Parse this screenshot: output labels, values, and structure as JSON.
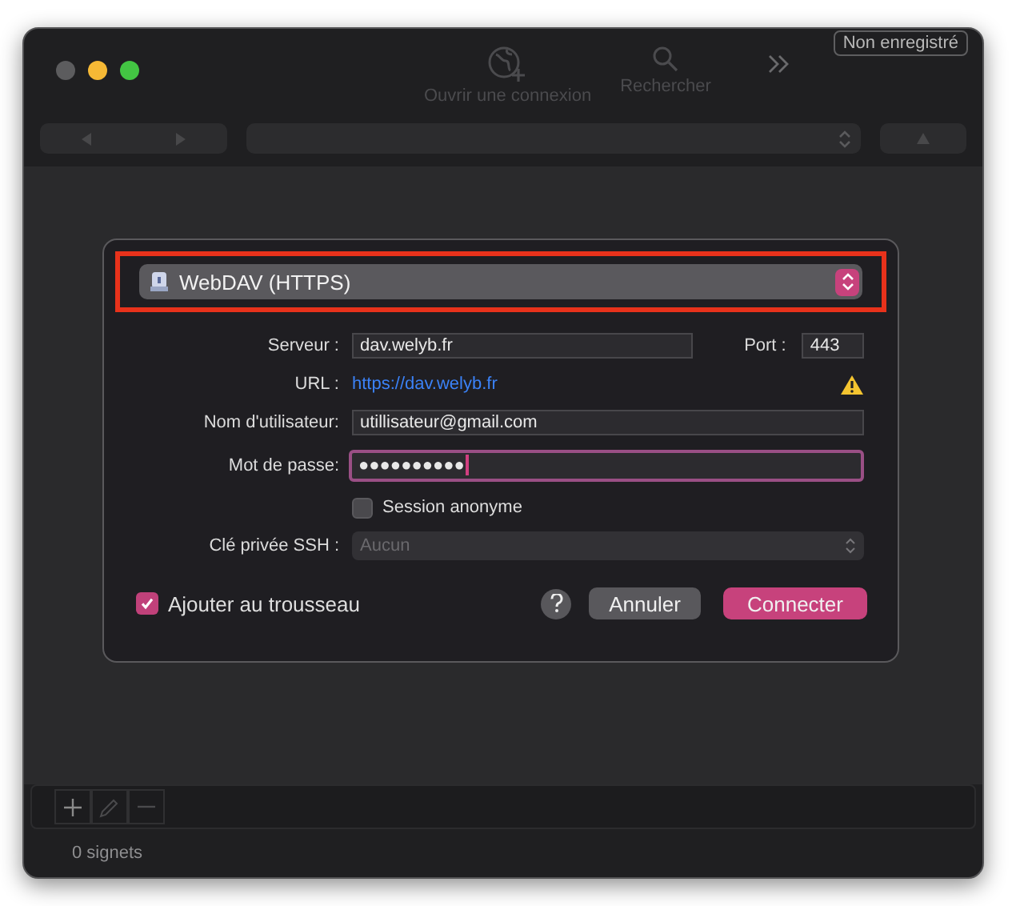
{
  "window": {
    "badge": "Non enregistré"
  },
  "toolbar": [
    {
      "label": "Ouvrir une connexion",
      "disabled": true
    },
    {
      "label": "Rechercher",
      "disabled": true
    }
  ],
  "dialog": {
    "protocol": "WebDAV (HTTPS)",
    "highlighted": true,
    "server": {
      "label": "Serveur :",
      "value": "dav.welyb.fr"
    },
    "port": {
      "label": "Port :",
      "value": "443"
    },
    "url": {
      "label": "URL :",
      "link": "https://dav.welyb.fr",
      "warning": true
    },
    "username": {
      "label": "Nom d'utilisateur:",
      "value": "utillisateur@gmail.com"
    },
    "password": {
      "label": "Mot de passe:",
      "value": "●●●●●●●●●●",
      "focused": true
    },
    "anonymous": {
      "label": "Session anonyme",
      "checked": false
    },
    "ssh_key": {
      "label": "Clé privée SSH :",
      "value": "Aucun",
      "disabled": true
    },
    "keychain": {
      "label": "Ajouter au trousseau",
      "checked": true
    },
    "buttons": [
      {
        "label": "Annuler",
        "kind": "secondary"
      },
      {
        "label": "Connecter",
        "kind": "primary"
      }
    ]
  },
  "status_bar": "0 signets"
}
